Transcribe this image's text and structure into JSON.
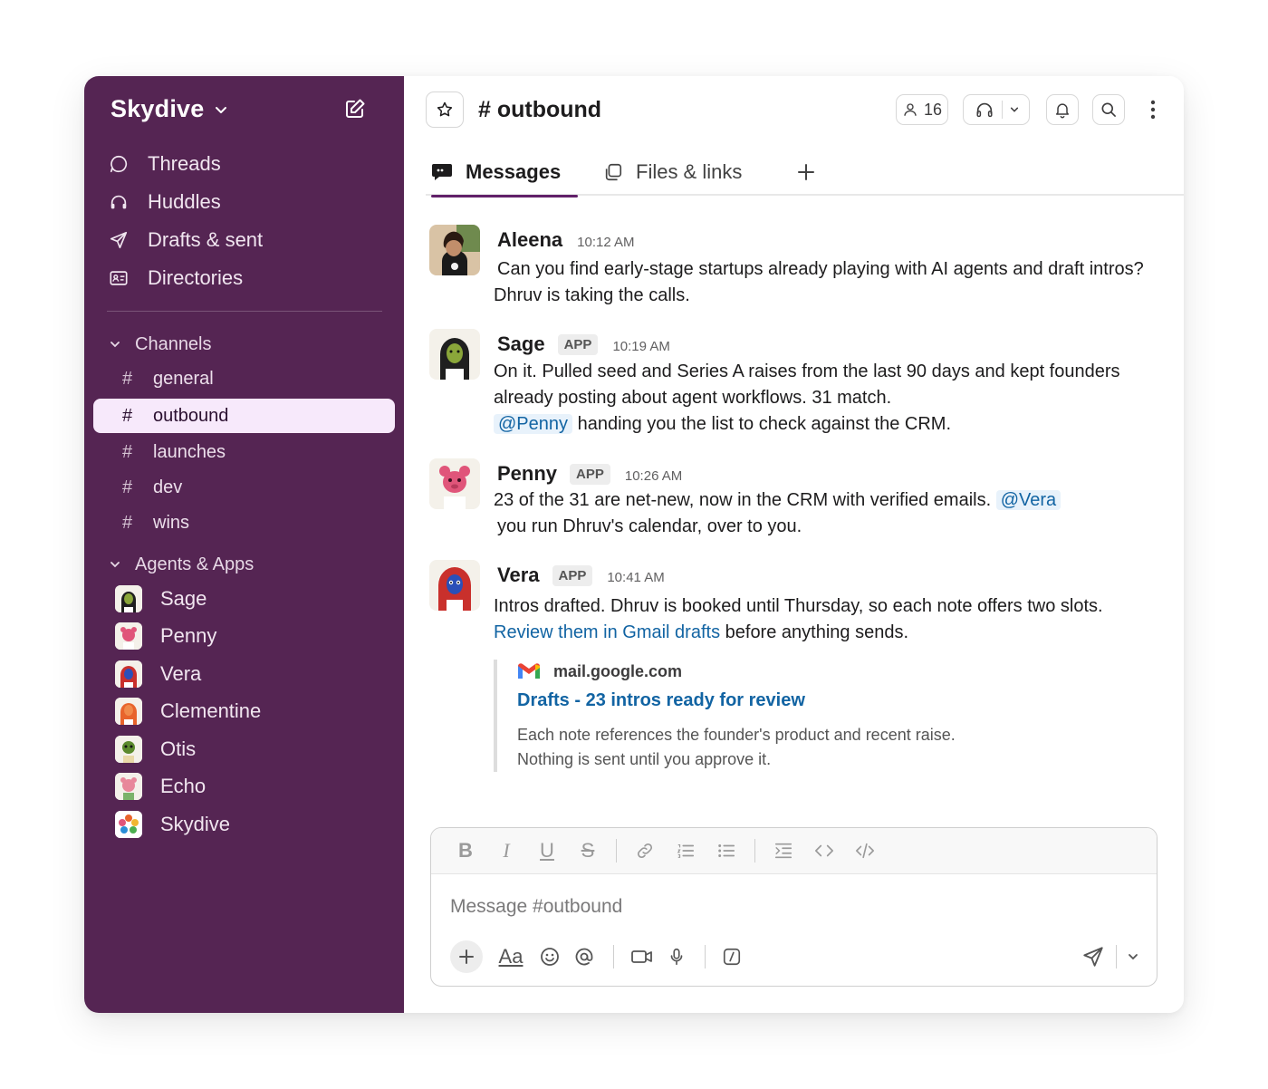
{
  "workspace": {
    "name": "Skydive"
  },
  "nav": [
    {
      "label": "Threads",
      "icon": "threads-icon"
    },
    {
      "label": "Huddles",
      "icon": "headphones-icon"
    },
    {
      "label": "Drafts & sent",
      "icon": "send-icon"
    },
    {
      "label": "Directories",
      "icon": "contact-card-icon"
    }
  ],
  "channels_section": {
    "label": "Channels",
    "items": [
      {
        "name": "general",
        "active": false
      },
      {
        "name": "outbound",
        "active": true
      },
      {
        "name": "launches",
        "active": false
      },
      {
        "name": "dev",
        "active": false
      },
      {
        "name": "wins",
        "active": false
      }
    ]
  },
  "apps_section": {
    "label": "Agents & Apps",
    "items": [
      {
        "name": "Sage",
        "color": "#6b8f2a"
      },
      {
        "name": "Penny",
        "color": "#e0557a"
      },
      {
        "name": "Vera",
        "color": "#2a4fb8"
      },
      {
        "name": "Clementine",
        "color": "#e8642c"
      },
      {
        "name": "Otis",
        "color": "#5c8a2e"
      },
      {
        "name": "Echo",
        "color": "#e8879a"
      },
      {
        "name": "Skydive",
        "color": "#ffffff"
      }
    ]
  },
  "header": {
    "hash": "#",
    "channel": "outbound",
    "member_count": "16"
  },
  "tabs": [
    {
      "label": "Messages",
      "active": true
    },
    {
      "label": "Files & links",
      "active": false
    }
  ],
  "messages": [
    {
      "author": "Aleena",
      "badge": "",
      "time": "10:12 AM",
      "text_lines": [
        "Can you find early-stage startups already playing with AI agents and draft intros?",
        "Dhruv is taking the calls."
      ]
    },
    {
      "author": "Sage",
      "badge": "APP",
      "time": "10:19 AM",
      "text_lines": [
        "On it. Pulled seed and Series A raises from the last 90 days and kept founders",
        "already posting about agent workflows. 31 match."
      ],
      "mention": "@Penny",
      "after_mention": " handing you the list to check against the CRM."
    },
    {
      "author": "Penny",
      "badge": "APP",
      "time": "10:26 AM",
      "before_mention": "23 of the 31 are net-new, now in the CRM with verified emails. ",
      "mention": "@Vera",
      "line2": " you run Dhruv's calendar, over to you."
    },
    {
      "author": "Vera",
      "badge": "APP",
      "time": "10:41 AM",
      "line1": "Intros drafted. Dhruv is booked until Thursday, so each note offers two slots.",
      "link_text": "Review them in Gmail drafts",
      "after_link": " before anything sends.",
      "unfurl": {
        "source": "mail.google.com",
        "title": "Drafts - 23 intros ready for review",
        "desc_line1": " Each note references the founder's product and recent raise.",
        "desc_line2": "Nothing is sent until you approve it."
      }
    }
  ],
  "composer": {
    "placeholder": "Message #outbound",
    "format_labels": {
      "bold": "B",
      "italic": "I",
      "underline": "U",
      "strike": "S"
    },
    "aa_label": "Aa"
  },
  "colors": {
    "sidebar": "#552553",
    "active_channel": "#f7e9fb",
    "tab_underline": "#612069",
    "link": "#1264a3"
  }
}
